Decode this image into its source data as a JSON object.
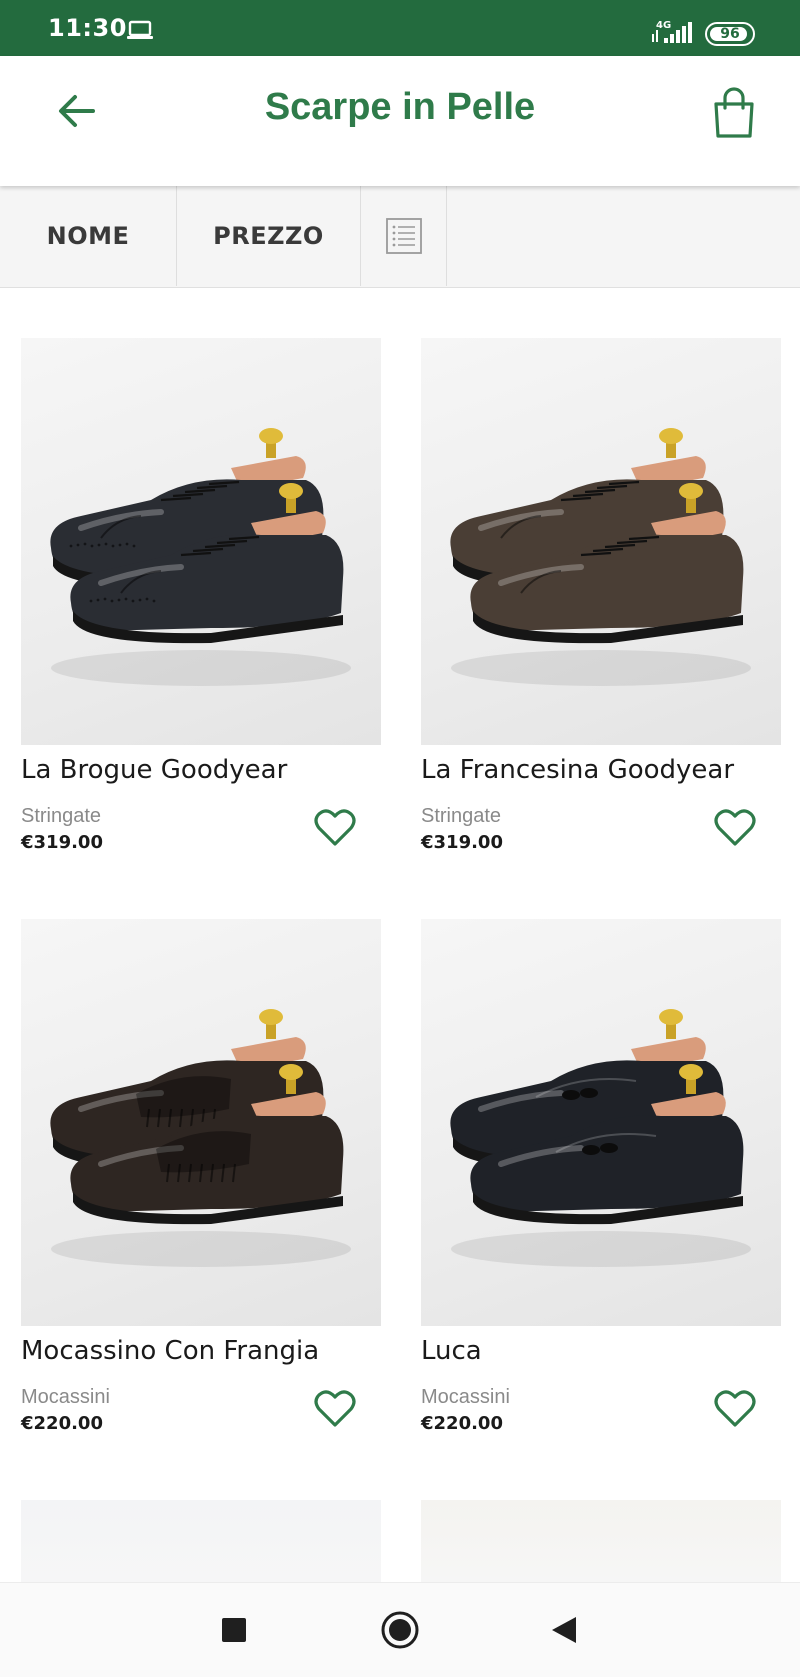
{
  "status_bar": {
    "time": "11:30",
    "network": "4G",
    "battery": "96",
    "icons": [
      "laptop-icon",
      "signal-icon",
      "battery-icon"
    ]
  },
  "header": {
    "title": "Scarpe in Pelle",
    "back_icon": "arrow-left-icon",
    "cart_icon": "shopping-bag-icon",
    "accent_color": "#2f7b4a",
    "status_color": "#236b3e"
  },
  "sort_bar": {
    "name_label": "NOME",
    "price_label": "PREZZO",
    "view_icon": "list-view-icon"
  },
  "products": [
    {
      "name": "La Brogue Goodyear",
      "category": "Stringate",
      "price": "€319.00",
      "shoe_color": "#2a2d33",
      "style": "brogue"
    },
    {
      "name": "La Francesina Goodyear",
      "category": "Stringate",
      "price": "€319.00",
      "shoe_color": "#4a3e35",
      "style": "oxford"
    },
    {
      "name": "Mocassino Con Frangia",
      "category": "Mocassini",
      "price": "€220.00",
      "shoe_color": "#2e2622",
      "style": "loafer-fringe"
    },
    {
      "name": "Luca",
      "category": "Mocassini",
      "price": "€220.00",
      "shoe_color": "#1f2228",
      "style": "loafer-tassel"
    }
  ],
  "nav": {
    "icons": [
      "square-recents-icon",
      "circle-home-icon",
      "triangle-back-icon"
    ]
  }
}
